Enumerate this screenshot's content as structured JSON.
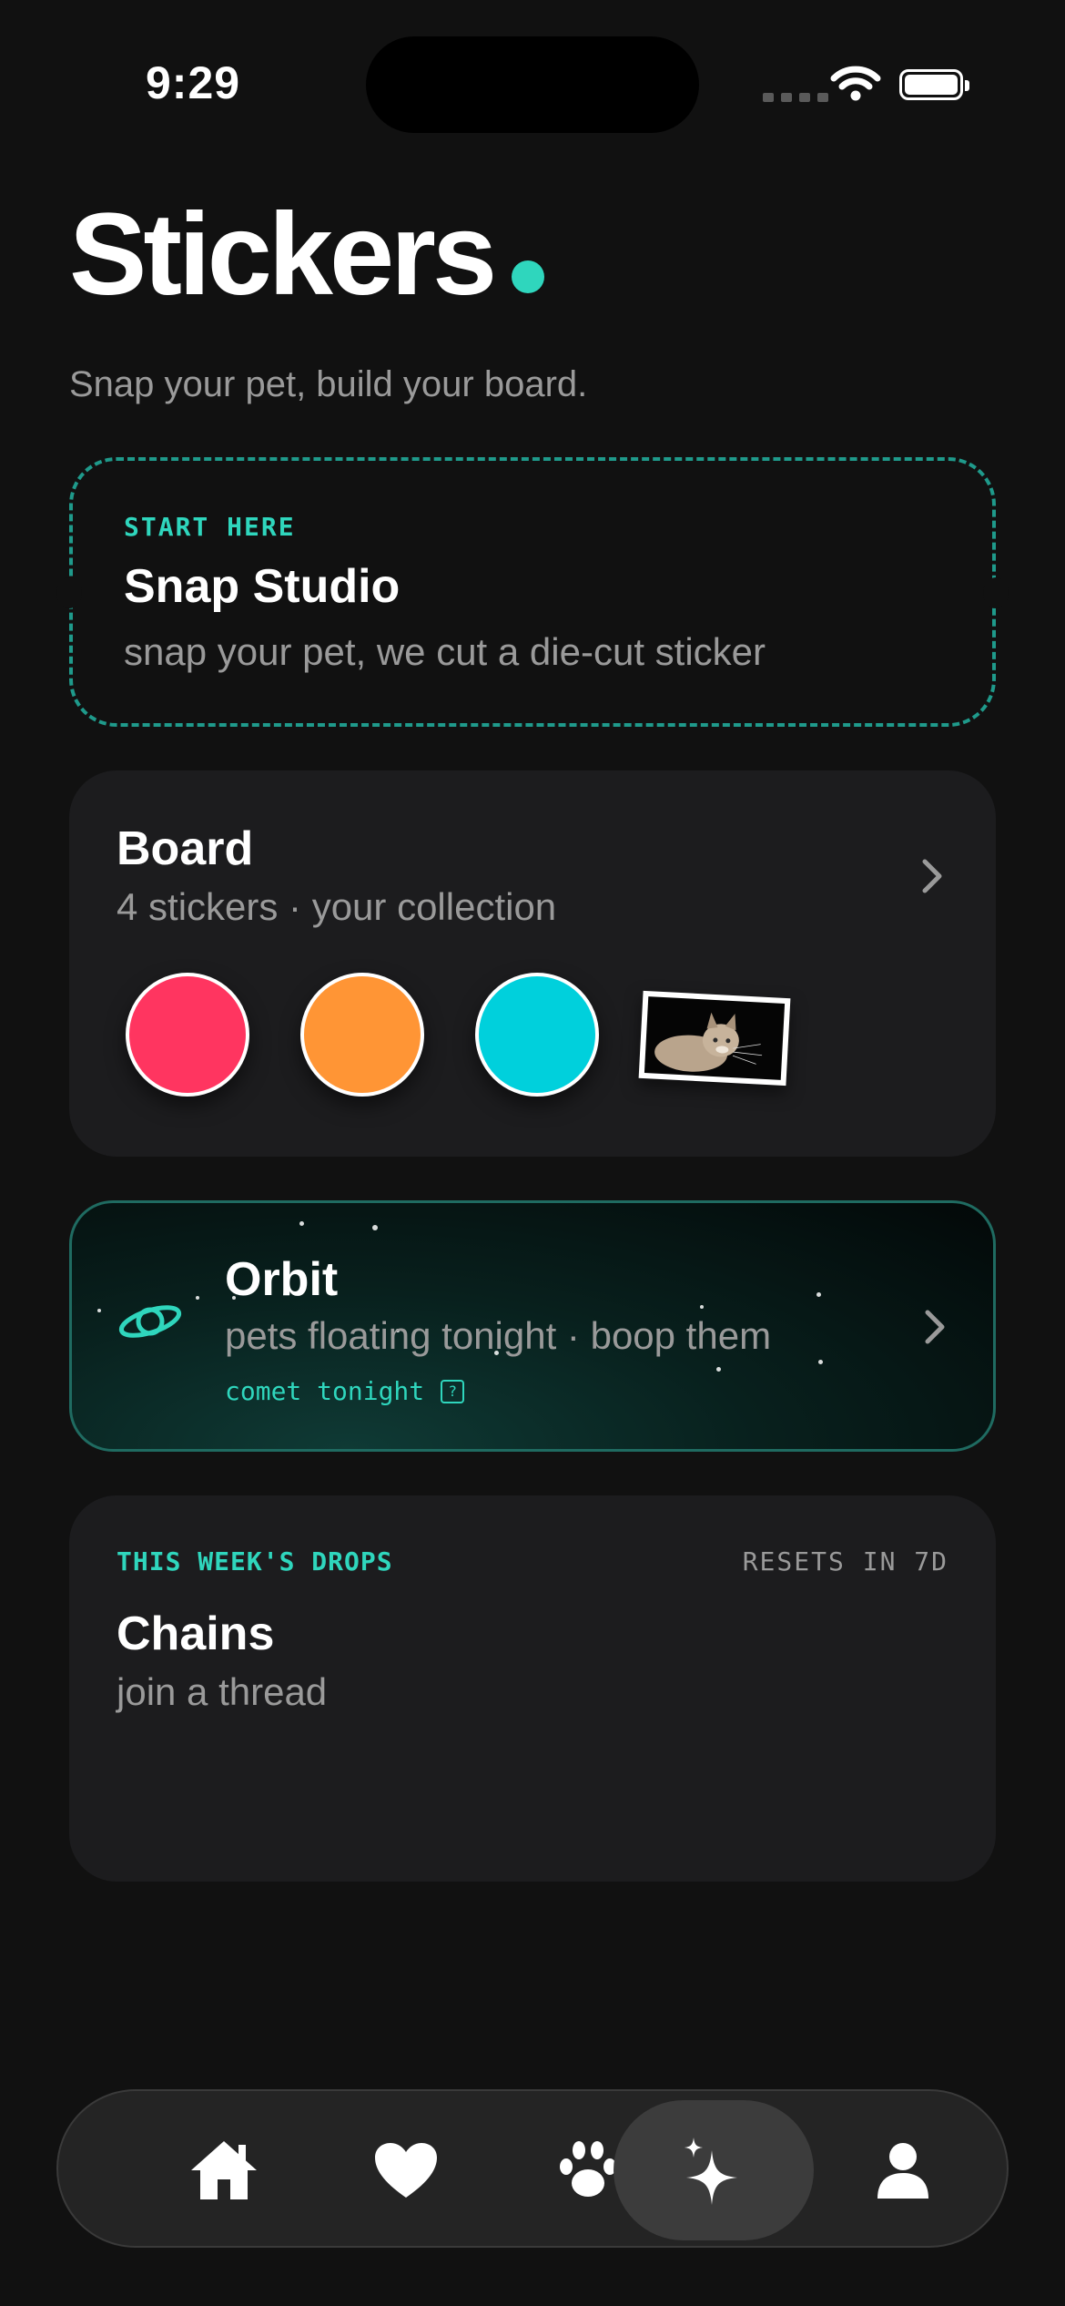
{
  "status_bar": {
    "time": "9:29"
  },
  "header": {
    "title": "Stickers",
    "subtitle": "Snap your pet, build your board.",
    "accent_color": "#2fd6bd"
  },
  "snap_studio": {
    "eyebrow": "START HERE",
    "title": "Snap Studio",
    "subtitle": "snap your pet, we cut a die-cut sticker"
  },
  "board": {
    "title": "Board",
    "subtitle": "4 stickers · your collection",
    "stickers": [
      {
        "type": "color",
        "color": "#ff3560"
      },
      {
        "type": "color",
        "color": "#ff9535"
      },
      {
        "type": "color",
        "color": "#00d0dc"
      },
      {
        "type": "photo",
        "subject": "cat"
      }
    ]
  },
  "orbit": {
    "title": "Orbit",
    "subtitle": "pets floating tonight · boop them",
    "note": "comet tonight",
    "note_icon": "?",
    "icon": "planet-icon"
  },
  "drops": {
    "eyebrow": "THIS WEEK'S DROPS",
    "reset": "RESETS IN 7D",
    "title": "Chains",
    "subtitle": "join a thread"
  },
  "tabbar": {
    "tabs": [
      {
        "icon": "home-icon",
        "active": false
      },
      {
        "icon": "heart-icon",
        "active": false
      },
      {
        "icon": "paw-icon",
        "active": false
      },
      {
        "icon": "sparkles-icon",
        "active": true
      },
      {
        "icon": "profile-icon",
        "active": false
      }
    ]
  }
}
